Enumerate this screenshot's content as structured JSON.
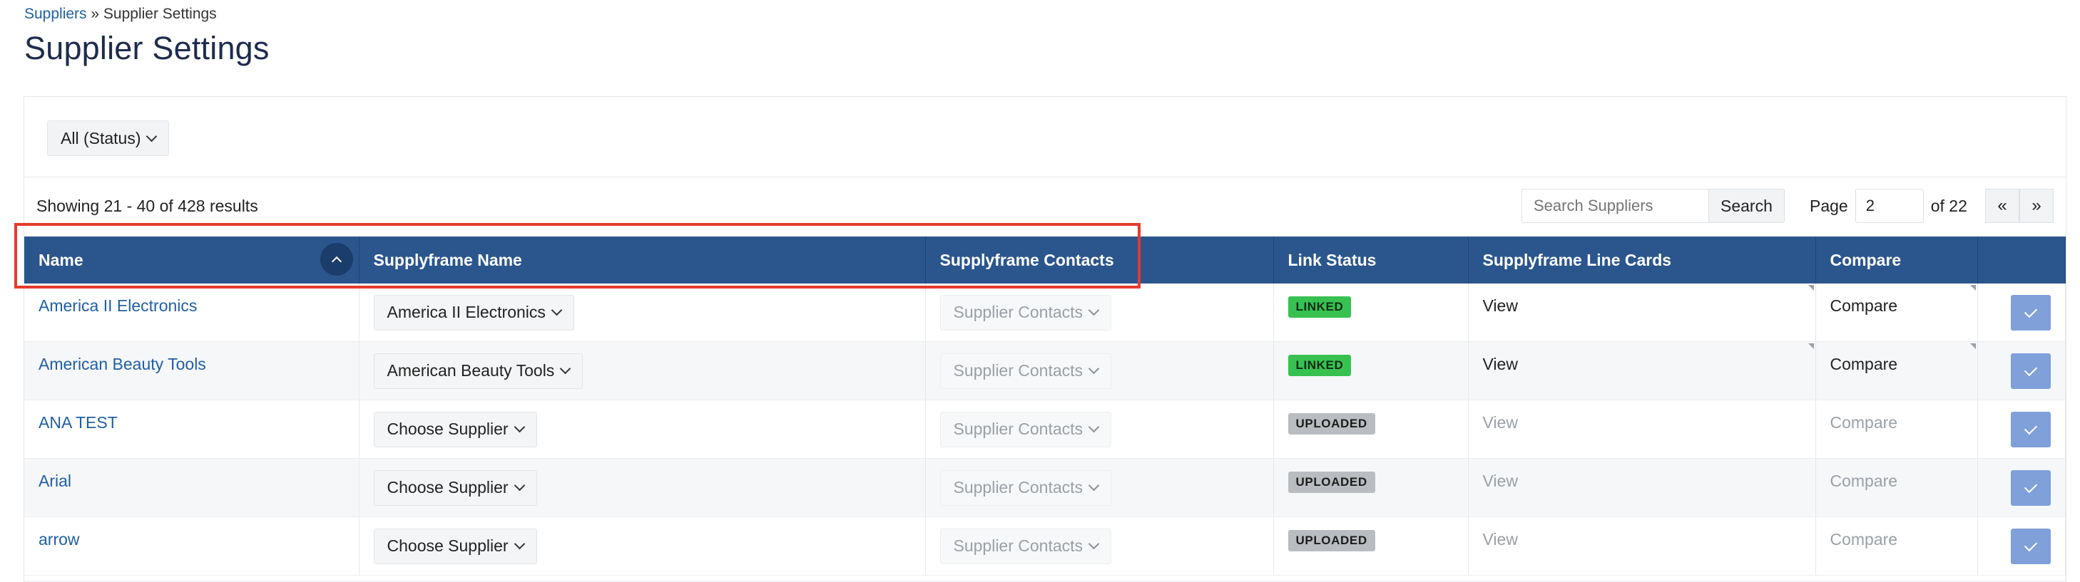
{
  "breadcrumb": {
    "link": "Suppliers",
    "separator": " » ",
    "current": "Supplier Settings"
  },
  "page_title": "Supplier Settings",
  "filters": {
    "status_label": "All (Status)"
  },
  "results": {
    "showing_text": "Showing 21 - 40 of 428 results"
  },
  "search": {
    "placeholder": "Search Suppliers",
    "button_label": "Search"
  },
  "pagination": {
    "page_label": "Page",
    "current_page": "2",
    "total_text": "of 22",
    "prev_label": "«",
    "next_label": "»"
  },
  "table": {
    "columns": [
      {
        "label": "Name"
      },
      {
        "label": "Supplyframe Name"
      },
      {
        "label": "Supplyframe Contacts"
      },
      {
        "label": "Link Status"
      },
      {
        "label": "Supplyframe Line Cards"
      },
      {
        "label": "Compare"
      },
      {
        "label": ""
      }
    ],
    "rows": [
      {
        "name": "America II Electronics",
        "supplyframe_name": "America II Electronics",
        "contacts": "Supplier Contacts",
        "status": "LINKED",
        "line_cards": "View",
        "compare": "Compare"
      },
      {
        "name": "American Beauty Tools",
        "supplyframe_name": "American Beauty Tools",
        "contacts": "Supplier Contacts",
        "status": "LINKED",
        "line_cards": "View",
        "compare": "Compare"
      },
      {
        "name": "ANA TEST",
        "supplyframe_name": "Choose Supplier",
        "contacts": "Supplier Contacts",
        "status": "UPLOADED",
        "line_cards": "View",
        "compare": "Compare"
      },
      {
        "name": "Arial",
        "supplyframe_name": "Choose Supplier",
        "contacts": "Supplier Contacts",
        "status": "UPLOADED",
        "line_cards": "View",
        "compare": "Compare"
      },
      {
        "name": "arrow",
        "supplyframe_name": "Choose Supplier",
        "contacts": "Supplier Contacts",
        "status": "UPLOADED",
        "line_cards": "View",
        "compare": "Compare"
      }
    ]
  },
  "colors": {
    "header_bg": "#2b568d",
    "link": "#1f5fa6",
    "linked_badge": "#37c151",
    "uploaded_badge": "#b9bcc0",
    "highlight_border": "#e53b2c",
    "check_button": "#7fa0d9"
  }
}
